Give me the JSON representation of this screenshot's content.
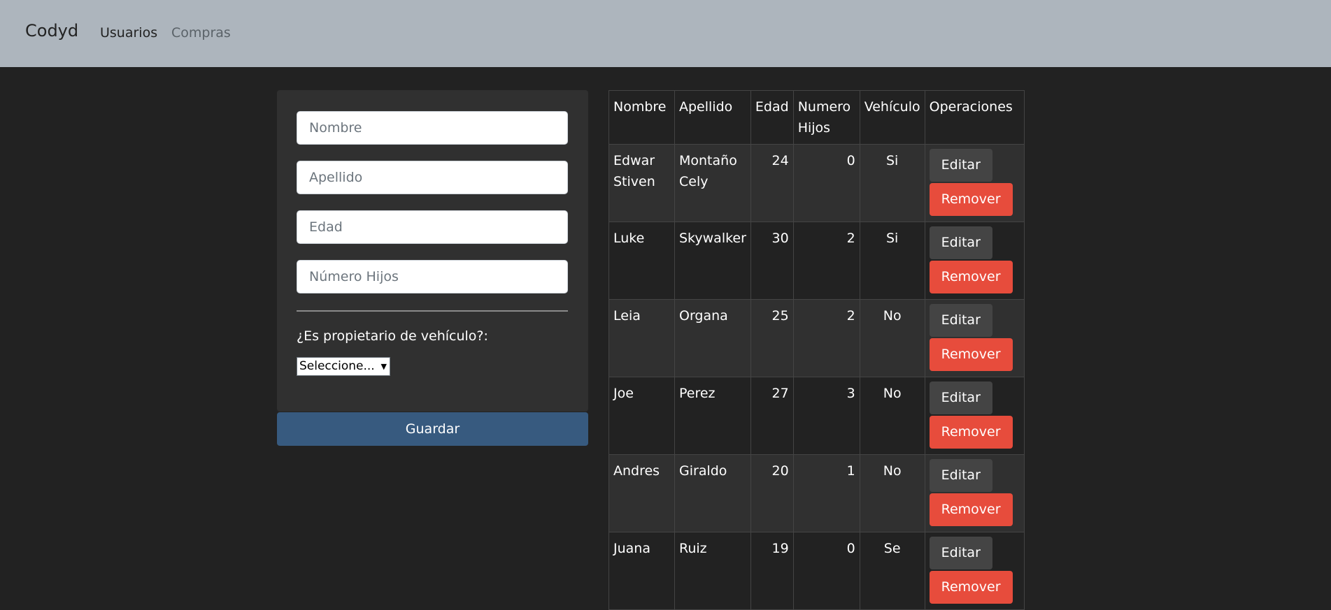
{
  "navbar": {
    "brand": "Codyd",
    "links": [
      "Usuarios",
      "Compras"
    ]
  },
  "form": {
    "nombre_placeholder": "Nombre",
    "apellido_placeholder": "Apellido",
    "edad_placeholder": "Edad",
    "hijos_placeholder": "Número Hijos",
    "vehicle_question": "¿Es propietario de vehículo?:",
    "vehicle_select_value": "Seleccione...",
    "save_label": "Guardar"
  },
  "table": {
    "headers": [
      "Nombre",
      "Apellido",
      "Edad",
      "Numero Hijos",
      "Vehículo",
      "Operaciones"
    ],
    "rows": [
      {
        "nombre": "Edwar Stiven",
        "apellido": "Montaño Cely",
        "edad": "24",
        "hijos": "0",
        "vehiculo": "Si"
      },
      {
        "nombre": "Luke",
        "apellido": "Skywalker",
        "edad": "30",
        "hijos": "2",
        "vehiculo": "Si"
      },
      {
        "nombre": "Leia",
        "apellido": "Organa",
        "edad": "25",
        "hijos": "2",
        "vehiculo": "No"
      },
      {
        "nombre": "Joe",
        "apellido": "Perez",
        "edad": "27",
        "hijos": "3",
        "vehiculo": "No"
      },
      {
        "nombre": "Andres",
        "apellido": "Giraldo",
        "edad": "20",
        "hijos": "1",
        "vehiculo": "No"
      },
      {
        "nombre": "Juana",
        "apellido": "Ruiz",
        "edad": "19",
        "hijos": "0",
        "vehiculo": "Se"
      }
    ],
    "edit_label": "Editar",
    "remove_label": "Remover"
  },
  "colors": {
    "navbar_bg": "#adb5bd",
    "page_bg": "#222222",
    "primary": "#375a7f",
    "danger": "#e74c3c",
    "secondary": "#444444"
  }
}
